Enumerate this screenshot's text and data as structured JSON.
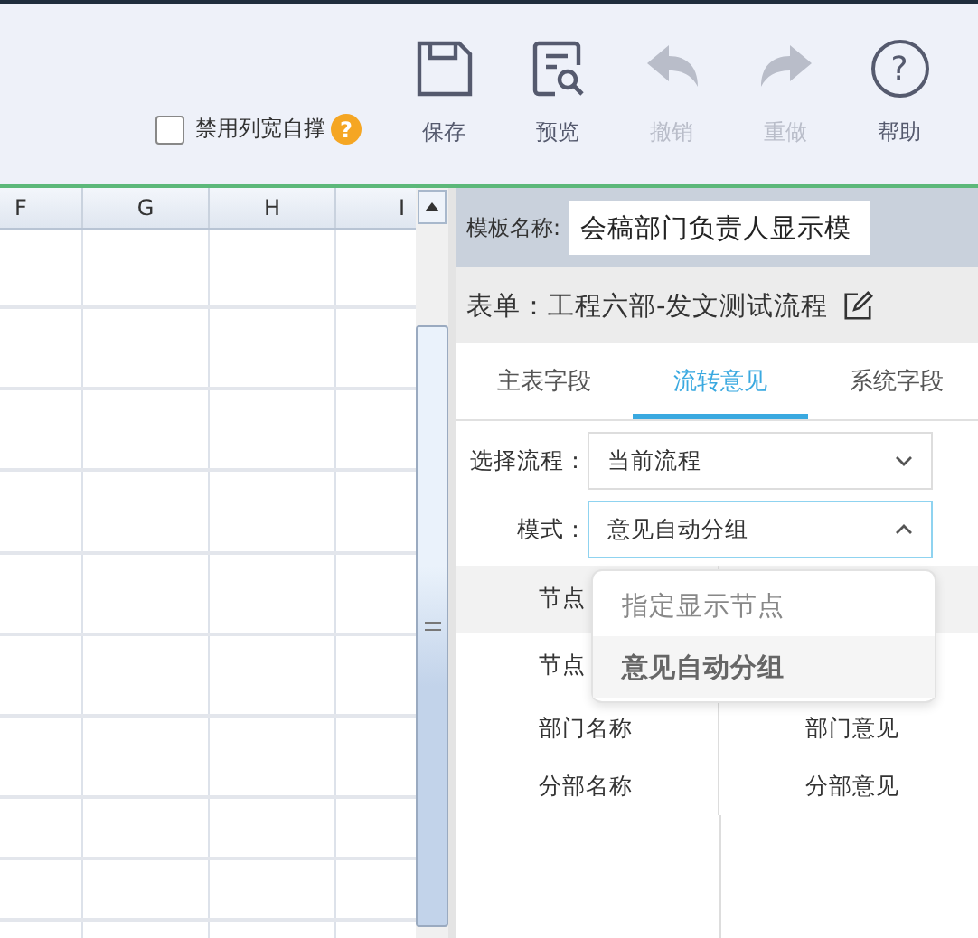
{
  "toolbar": {
    "checkbox": {
      "label": "禁用列宽自撑",
      "checked": false
    },
    "hint_badge": "?",
    "buttons": [
      {
        "kind": "save",
        "label": "保存",
        "disabled": false
      },
      {
        "kind": "preview",
        "label": "预览",
        "disabled": false
      },
      {
        "kind": "undo",
        "label": "撤销",
        "disabled": true
      },
      {
        "kind": "redo",
        "label": "重做",
        "disabled": true
      },
      {
        "kind": "help",
        "label": "帮助",
        "disabled": false,
        "glyph": "?"
      }
    ]
  },
  "sheet": {
    "columns": [
      "F",
      "G",
      "H",
      "I"
    ]
  },
  "panel": {
    "template_label": "模板名称:",
    "template_name": "会稿部门负责人显示模",
    "form_title": "表单：工程六部-发文测试流程",
    "tabs": [
      {
        "label": "主表字段",
        "selected": false
      },
      {
        "label": "流转意见",
        "selected": true
      },
      {
        "label": "系统字段",
        "selected": false
      }
    ],
    "fields": [
      {
        "label": "选择流程：",
        "value": "当前流程",
        "expanded": false
      },
      {
        "label": "模式：",
        "value": "意见自动分组",
        "expanded": true
      }
    ],
    "dropdown": [
      {
        "label": "指定显示节点",
        "selected": false
      },
      {
        "label": "意见自动分组",
        "selected": true
      }
    ],
    "rows": [
      {
        "name": "节点",
        "highlighted": true
      },
      {
        "name": "节点",
        "highlighted": false
      },
      {
        "name": "部门名称",
        "opinion": "部门意见",
        "highlighted": false
      },
      {
        "name": "分部名称",
        "opinion": "分部意见",
        "highlighted": false
      }
    ]
  }
}
